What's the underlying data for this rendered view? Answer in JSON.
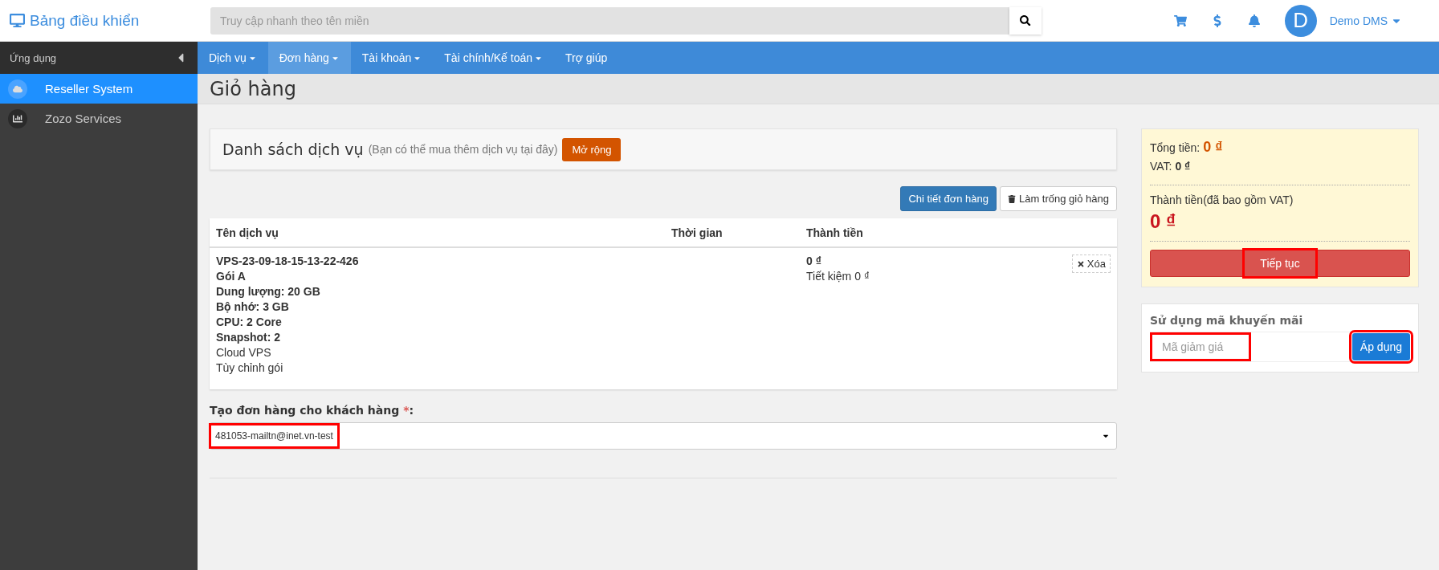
{
  "brand": {
    "title": "Bảng điều khiển"
  },
  "search": {
    "placeholder": "Truy cập nhanh theo tên miền"
  },
  "user": {
    "initial": "D",
    "name": "Demo DMS"
  },
  "sidebar": {
    "heading": "Ứng dụng",
    "items": [
      {
        "label": "Reseller System",
        "selected": true
      },
      {
        "label": "Zozo Services",
        "selected": false
      }
    ]
  },
  "nav": [
    {
      "label": "Dịch vụ",
      "dropdown": true,
      "selected": false
    },
    {
      "label": "Đơn hàng",
      "dropdown": true,
      "selected": true
    },
    {
      "label": "Tài khoản",
      "dropdown": true,
      "selected": false
    },
    {
      "label": "Tài chính/Kế toán",
      "dropdown": true,
      "selected": false
    },
    {
      "label": "Trợ giúp",
      "dropdown": false,
      "selected": false
    }
  ],
  "page_title": "Giỏ hàng",
  "services_panel": {
    "title": "Danh sách dịch vụ",
    "note": "(Bạn có thể mua thêm dịch vụ tại đây)",
    "button": "Mở rộng"
  },
  "actions": [
    {
      "label": "Chi tiết đơn hàng",
      "kind": "primary"
    },
    {
      "label": "Làm trống giỏ hàng",
      "kind": "trash"
    }
  ],
  "table": {
    "columns": [
      "Tên dịch vụ",
      "Thời gian",
      "Thành tiền"
    ],
    "rows": [
      {
        "details": [
          {
            "text": "VPS-23-09-18-15-13-22-426",
            "bold": true
          },
          {
            "text": "Gói A",
            "bold": true
          },
          {
            "text": "Dung lượng: 20 GB",
            "bold": true
          },
          {
            "text": "Bộ nhớ: 3 GB",
            "bold": true
          },
          {
            "text": "CPU: 2 Core",
            "bold": true
          },
          {
            "text": "Snapshot: 2",
            "bold": true
          },
          {
            "text": "Cloud VPS",
            "bold": false
          },
          {
            "text": "Tùy chỉnh gói",
            "bold": false
          }
        ],
        "price": "0 ₫",
        "saving": "Tiết kiệm 0 ₫",
        "remove": "Xóa"
      }
    ]
  },
  "customer": {
    "label": "Tạo đơn hàng cho khách hàng",
    "required": "*",
    "suffix": ":",
    "value": "481053-mailtn@inet.vn-test",
    "highlighted": true
  },
  "summary": {
    "total_label": "Tổng tiền:",
    "total": "0 ₫",
    "vat_label": "VAT:",
    "vat": "0 ₫",
    "grand_label": "Thành tiền(đã bao gồm VAT)",
    "grand": "0 ₫",
    "button": "Tiếp tục",
    "button_highlighted": true
  },
  "promo": {
    "title": "Sử dụng mã khuyến mãi",
    "placeholder": "Mã giảm giá",
    "field_highlighted": true,
    "button": "Áp dụng",
    "button_highlighted": true
  }
}
